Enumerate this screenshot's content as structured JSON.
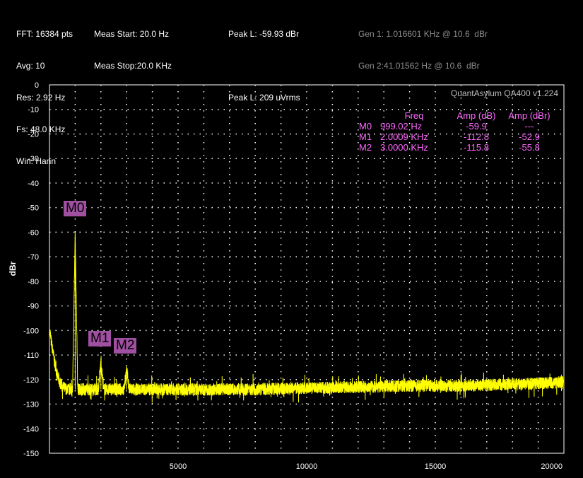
{
  "info": {
    "col1": [
      "FFT: 16384 pts",
      "Avg: 10",
      "Res: 2.92 Hz",
      "Fs: 48.0 KHz",
      "Win: Hann"
    ],
    "col2": [
      "Meas Start: 20.0 Hz",
      "Meas Stop:20.0 KHz"
    ],
    "col3": [
      "Peak L: -59.93 dBr",
      "",
      "Peak L: 209 uVrms"
    ],
    "gen": [
      "Gen 1: 1.016601 KHz @ 10.6  dBr",
      "Gen 2:41.01562 Hz @ 10.6  dBr"
    ]
  },
  "watermark": "QuantAsylum QA400 v1.224",
  "markers_table": {
    "headers": [
      "",
      "Freq",
      "Amp (dB)",
      "Amp (dBr)"
    ],
    "rows": [
      [
        "M0",
        "999.02 Hz",
        "-59.9",
        "---"
      ],
      [
        "M1",
        "2.0009 KHz",
        "-112.8",
        "-52.9"
      ],
      [
        "M2",
        "3.0000 KHz",
        "-115.8",
        "-55.8"
      ]
    ]
  },
  "marker_labels": [
    "M0",
    "M1",
    "M2"
  ],
  "colors": {
    "trace": "#ffff00",
    "marker_text": "#ff66ff",
    "marker_label_bg": "#a050a0",
    "grid": "#ffffff",
    "generator_text": "#8c8c8c"
  },
  "chart_data": {
    "type": "line",
    "title": "",
    "xlabel": "",
    "ylabel": "dBr",
    "xlim": [
      0,
      20000
    ],
    "ylim": [
      -150,
      0
    ],
    "x_ticks": [
      5000,
      10000,
      15000,
      20000
    ],
    "y_ticks": [
      0,
      -10,
      -20,
      -30,
      -40,
      -50,
      -60,
      -70,
      -80,
      -90,
      -100,
      -110,
      -120,
      -130,
      -140,
      -150
    ],
    "grid": true,
    "series": [
      {
        "points": [
          [
            20,
            -100
          ],
          [
            60,
            -104
          ],
          [
            120,
            -108
          ],
          [
            200,
            -113
          ],
          [
            300,
            -118
          ],
          [
            400,
            -121
          ],
          [
            500,
            -123
          ],
          [
            700,
            -124
          ],
          [
            900,
            -124
          ],
          [
            999,
            -60
          ],
          [
            1100,
            -124
          ],
          [
            1500,
            -124
          ],
          [
            1900,
            -124
          ],
          [
            2000,
            -112.8
          ],
          [
            2100,
            -124
          ],
          [
            2500,
            -124
          ],
          [
            2900,
            -124
          ],
          [
            3000,
            -115.8
          ],
          [
            3100,
            -124
          ],
          [
            4000,
            -124
          ],
          [
            6000,
            -124
          ],
          [
            8000,
            -124
          ],
          [
            10000,
            -123.5
          ],
          [
            12000,
            -123
          ],
          [
            14000,
            -122.5
          ],
          [
            16000,
            -122.5
          ],
          [
            18000,
            -122
          ],
          [
            20000,
            -121
          ]
        ]
      }
    ],
    "markers": [
      {
        "name": "M0",
        "x": 999.02,
        "y": -59.9
      },
      {
        "name": "M1",
        "x": 2000.9,
        "y": -112.8
      },
      {
        "name": "M2",
        "x": 3000.0,
        "y": -115.8
      }
    ]
  }
}
